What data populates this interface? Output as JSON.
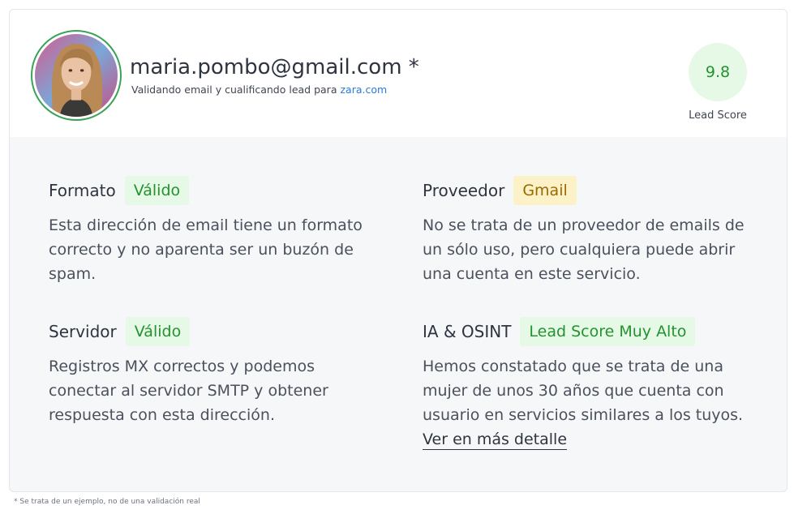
{
  "header": {
    "email": "maria.pombo@gmail.com *",
    "subtitle_prefix": "Validando email y cualificando lead para",
    "domain": "zara.com",
    "score": "9.8",
    "score_label": "Lead Score"
  },
  "sections": [
    {
      "title": "Formato",
      "badge": "Válido",
      "badge_color": "#24922f",
      "text": "Esta dirección de email tiene un formato correcto y no aparenta ser un buzón de spam."
    },
    {
      "title": "Proveedor",
      "badge": "Gmail",
      "badge_color": "#9a6a00",
      "text": "No se trata de un proveedor de emails de un sólo uso, pero cualquiera puede abrir una cuenta en este servicio."
    },
    {
      "title": "Servidor",
      "badge": "Válido",
      "badge_color": "#24922f",
      "text": "Registros MX correctos y podemos conectar al servidor SMTP y obtener respuesta con esta dirección."
    },
    {
      "title": "IA & OSINT",
      "badge": "Lead Score Muy Alto",
      "badge_color": "#24922f",
      "text": "Hemos constatado que se trata de una mujer de unos 30 años que cuenta con usuario en servicios similares a los tuyos.",
      "link": "Ver en más detalle"
    }
  ],
  "footnote": "* Se trata de un ejemplo, no de una validación real"
}
